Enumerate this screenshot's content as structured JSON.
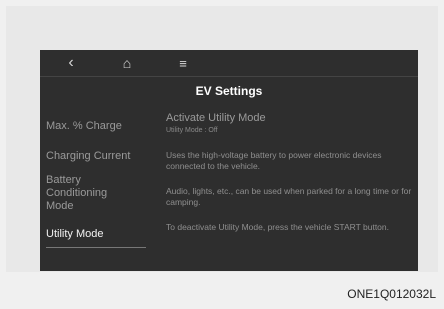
{
  "topbar": {
    "back_icon": "‹",
    "home_icon": "⌂",
    "menu_icon": "≡"
  },
  "screen": {
    "title": "EV Settings"
  },
  "menu": {
    "items": [
      {
        "label": "Max. % Charge"
      },
      {
        "label": "Charging Current"
      },
      {
        "label": "Battery Conditioning Mode"
      },
      {
        "label": "Utility Mode"
      }
    ]
  },
  "content": {
    "option_title": "Activate Utility Mode",
    "option_status": "Utility Mode : Off",
    "descriptions": [
      "Uses the high-voltage battery to power electronic devices connected to the vehicle.",
      "Audio, lights, etc., can be used when parked for a long time or for camping.",
      "To deactivate Utility Mode, press the vehicle START button."
    ]
  },
  "caption": "ONE1Q012032L"
}
